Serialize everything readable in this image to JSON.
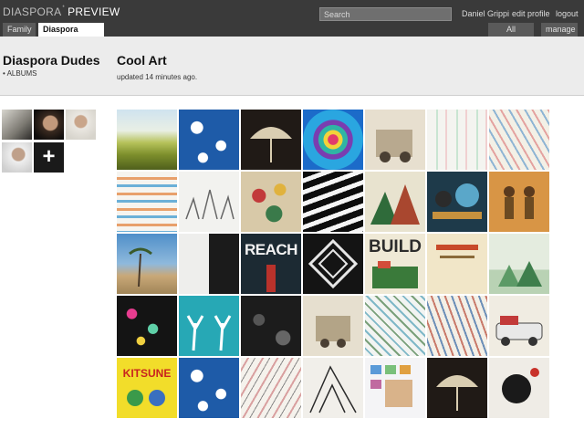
{
  "header": {
    "brand_name": "DIASPORA",
    "brand_mark": "*",
    "brand_suffix": "PREVIEW",
    "search_placeholder": "Search",
    "user_name": "Daniel Grippi",
    "edit_profile": "edit profile",
    "logout": "logout"
  },
  "tabs": {
    "family": "Family",
    "active": "Diaspora Dudes",
    "all_aspects": "All Aspects",
    "manage": "manage"
  },
  "aspect": {
    "title": "Diaspora Dudes",
    "albums_link": "• ALBUMS"
  },
  "album": {
    "title": "Cool Art",
    "updated": "updated 14 minutes ago."
  },
  "add_member_symbol": "+",
  "photo_texts": {
    "reach": "REACH",
    "build": "BUILD",
    "kitsune": "KITSUNE"
  },
  "colors": {
    "header_bg": "#3a3a3a",
    "subheader_bg": "#ececec"
  }
}
